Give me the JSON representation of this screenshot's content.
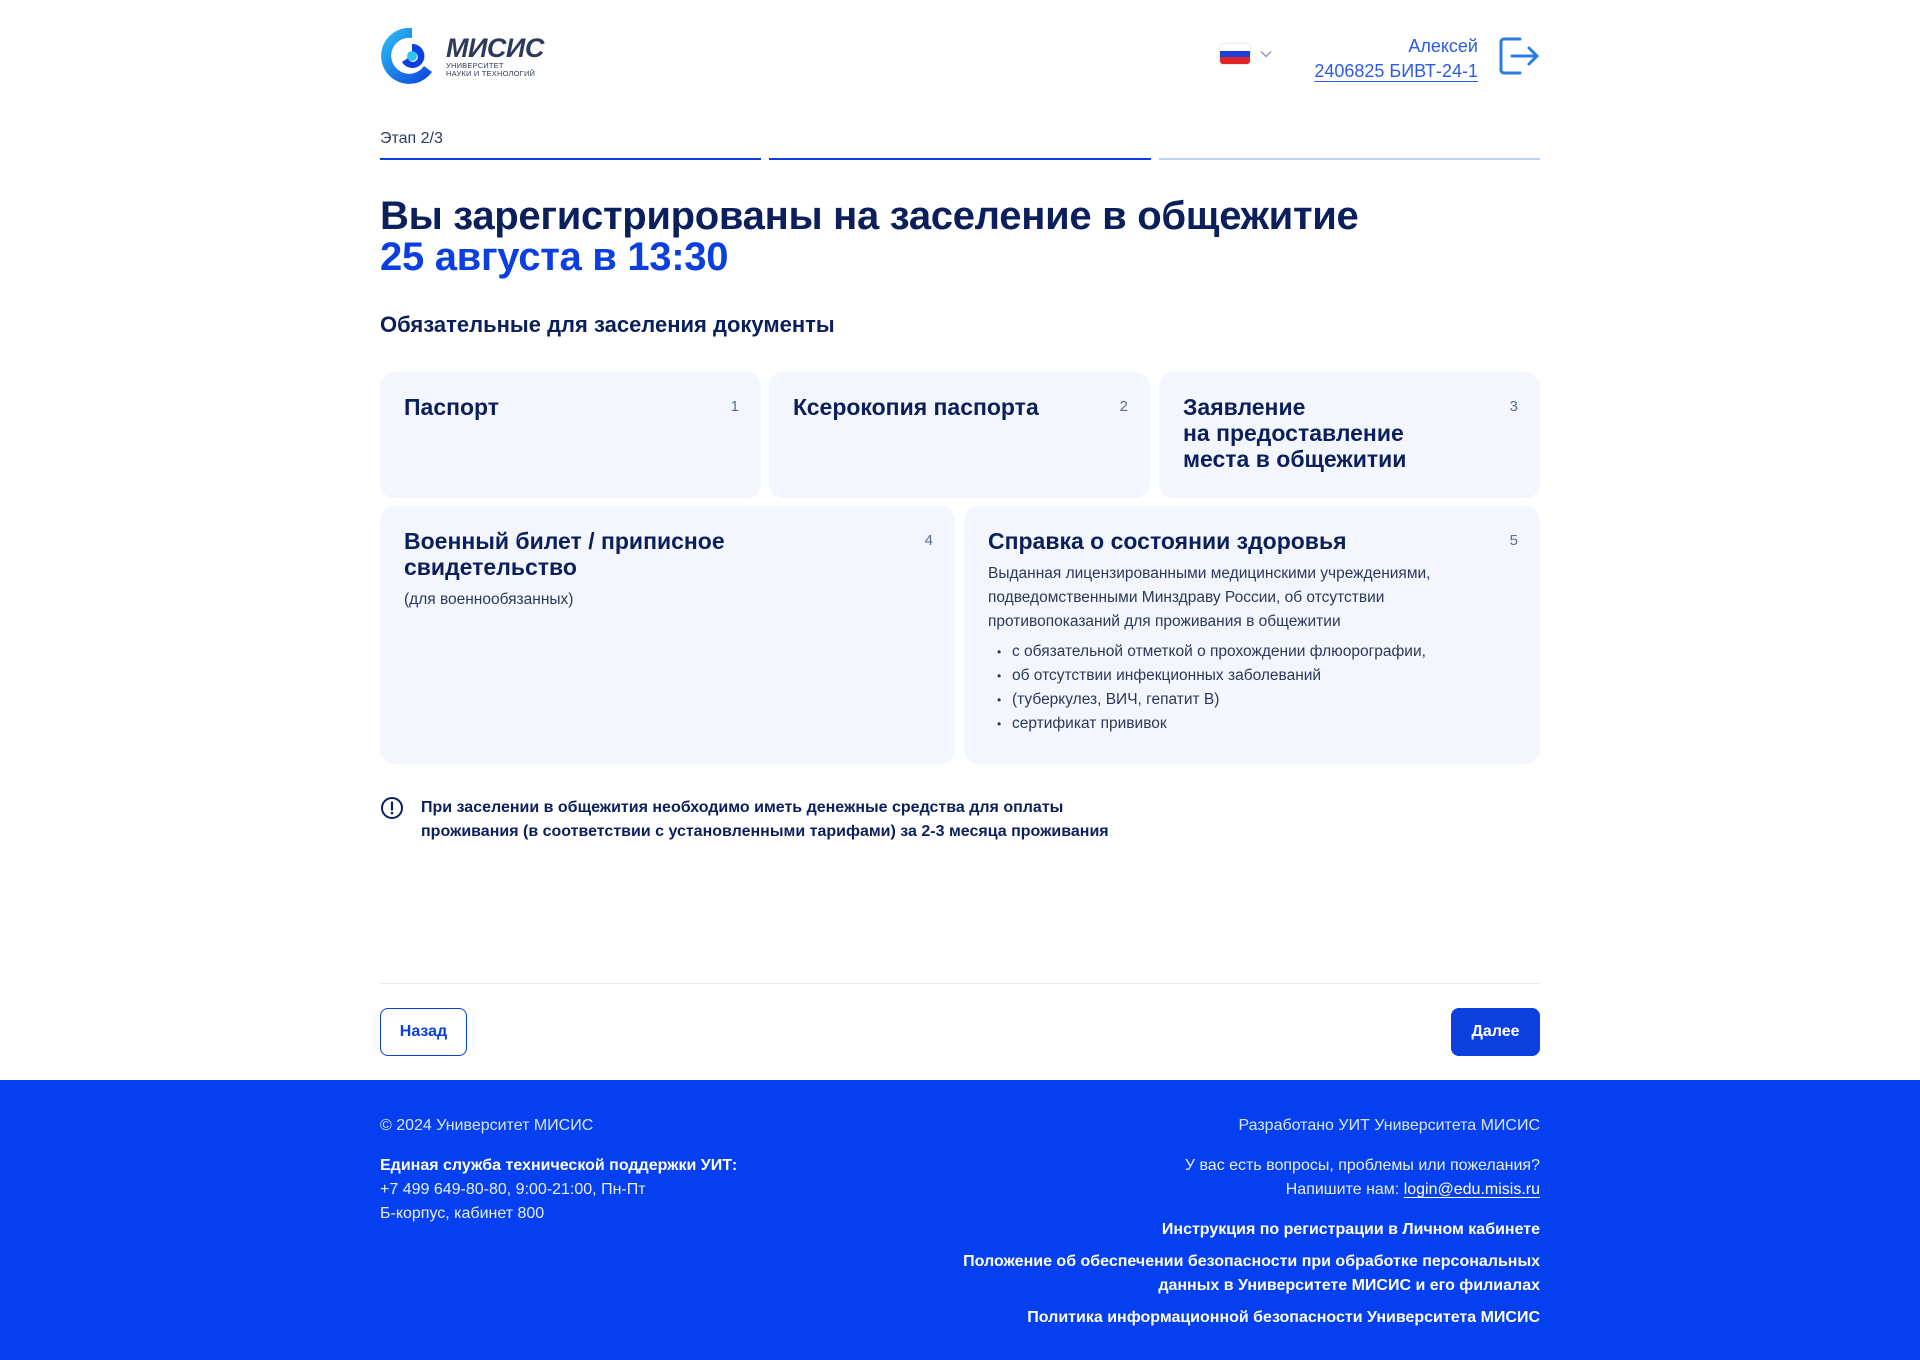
{
  "header": {
    "logo_name": "МИСИС",
    "logo_sub_1": "УНИВЕРСИТЕТ",
    "logo_sub_2": "НАУКИ И ТЕХНОЛОГИЙ",
    "language_icon": "russia-flag-icon",
    "user_name": "Алексей",
    "user_id": "2406825 БИВТ-24-1",
    "logout_icon": "logout-icon"
  },
  "stepper": {
    "label": "Этап 2/3",
    "steps_total": 3,
    "steps_completed": 2
  },
  "main": {
    "title": "Вы зарегистрированы на заселение в общежитие",
    "date": "25 августа в 13:30",
    "section_title": "Обязательные для заселения документы",
    "cards": [
      {
        "title": "Паспорт",
        "num": "1"
      },
      {
        "title": "Ксерокопия паспорта",
        "num": "2"
      },
      {
        "title_1": "Заявление",
        "title_2": "на предоставление",
        "title_3": "места в общежитии",
        "num": "3"
      },
      {
        "title": "Военный билет / приписное свидетельство",
        "num": "4",
        "text": "(для военнообязанных)"
      },
      {
        "title": "Справка о состоянии здоровья",
        "num": "5",
        "text_1": "Выданная лицензированными медицинскими учреждениями,",
        "text_2": "подведомственными Минздраву России, об отсутствии",
        "text_3": "противопоказаний для проживания в общежитии",
        "bullets": [
          "с обязательной отметкой о прохождении флюорографии,",
          "об отсутствии инфекционных заболеваний",
          "(туберкулез, ВИЧ, гепатит В)",
          "сертификат прививок"
        ]
      }
    ],
    "notice_icon": "exclamation-circle-icon",
    "notice_1": "При заселении в общежития необходимо иметь денежные средства для оплаты",
    "notice_2": "проживания (в соответствии с установленными тарифами) за 2-3 месяца проживания"
  },
  "buttons": {
    "back": "Назад",
    "next": "Далее"
  },
  "footer": {
    "copyright": "© 2024 Университет МИСИС",
    "support_title": "Единая служба технической поддержки УИТ:",
    "support_phone": "+7 499 649-80-80, 9:00-21:00, Пн-Пт",
    "support_room": "Б-корпус, кабинет 800",
    "developed": "Разработано УИТ Университета МИСИС",
    "question": "У вас есть вопросы, проблемы или пожелания?",
    "write_us": "Напишите нам: ",
    "email": "login@edu.misis.ru",
    "link_1": "Инструкция по регистрации в Личном кабинете",
    "link_2_a": "Положение об обеспечении безопасности при обработке персональных",
    "link_2_b": "данных в Университете МИСИС и его филиалах",
    "link_3": "Политика информационной безопасности Университета МИСИС"
  },
  "colors": {
    "primary": "#0b3fe0",
    "navy": "#0b1f5c",
    "card_bg": "#f3f6fd",
    "footer_bg": "#0440f0"
  }
}
